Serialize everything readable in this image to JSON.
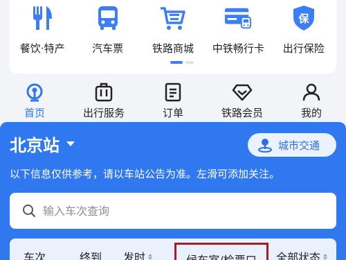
{
  "services": [
    {
      "label": "餐饮·特产",
      "icon": "fork-knife-icon"
    },
    {
      "label": "汽车票",
      "icon": "bus-icon"
    },
    {
      "label": "铁路商城",
      "icon": "shopping-cart-icon"
    },
    {
      "label": "中铁畅行卡",
      "icon": "rail-card-icon"
    },
    {
      "label": "出行保险",
      "icon": "insurance-shield-icon"
    }
  ],
  "nav": {
    "home": "首页",
    "travel": "出行服务",
    "orders": "订单",
    "member": "铁路会员",
    "mine": "我的"
  },
  "station": {
    "name": "北京站",
    "city_transport": "城市交通",
    "notice": "以下信息仅供参考，请以车站公告为准。左滑可添加关注。",
    "search_placeholder": "输入车次查询"
  },
  "table": {
    "train": "车次",
    "destination": "终到",
    "depart": "发时",
    "gate": "候车室/检票口",
    "status": "全部状态"
  },
  "colors": {
    "primary": "#2f78f0",
    "accent": "#3c7ef7",
    "highlight_border": "#b0191e"
  }
}
